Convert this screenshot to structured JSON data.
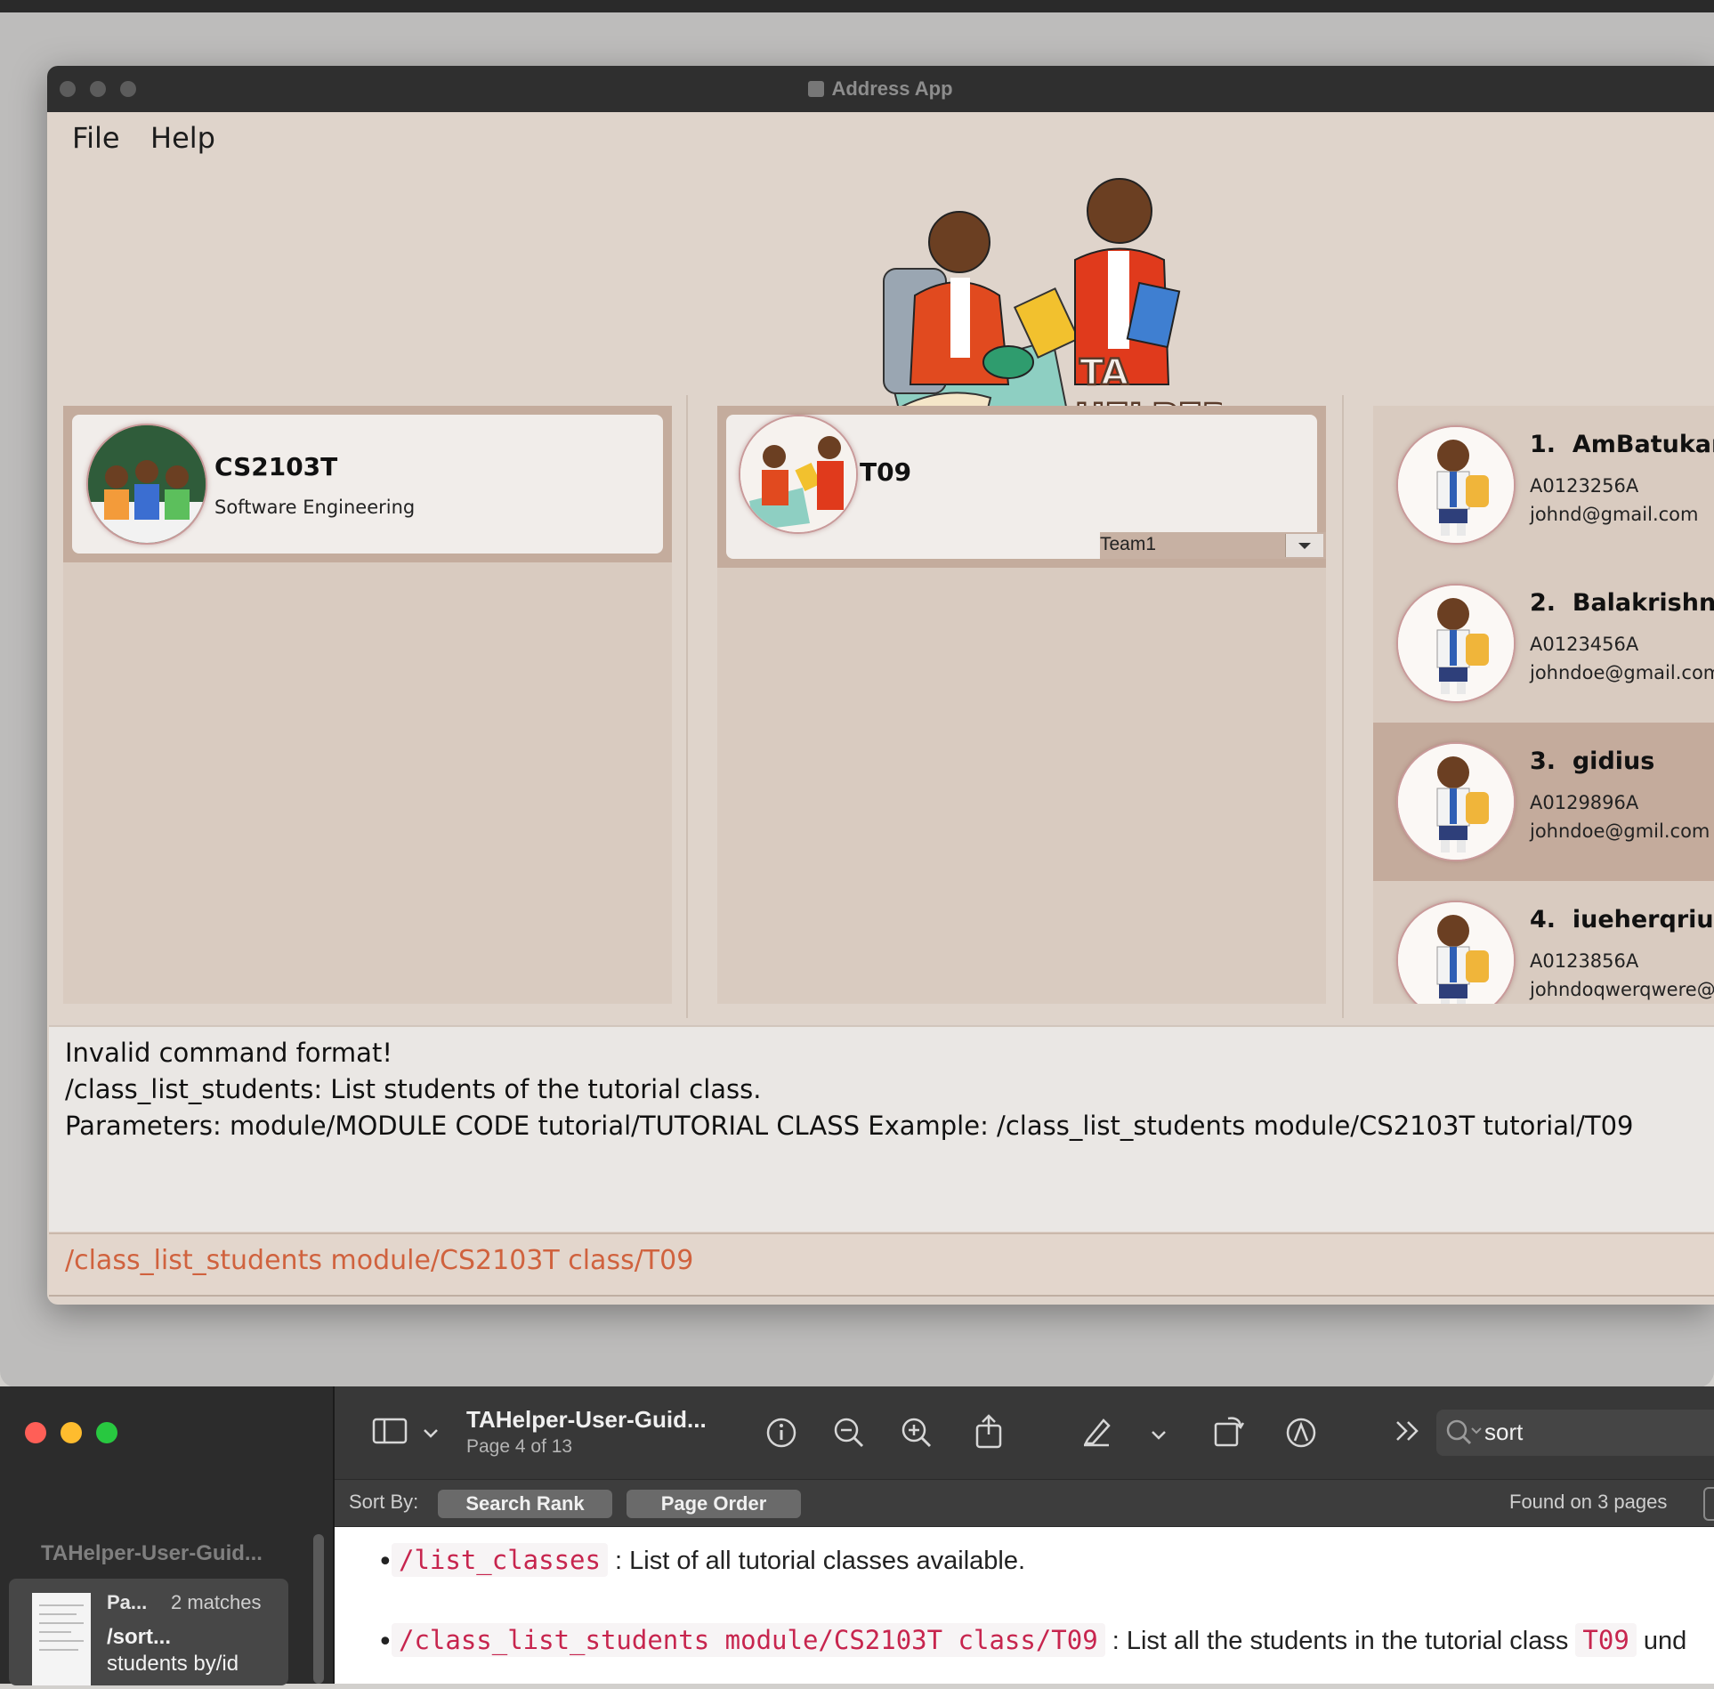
{
  "app": {
    "title": "Address App",
    "menu": [
      "File",
      "Help"
    ],
    "logo_text_top": "TA",
    "logo_text_bottom": "HELPER"
  },
  "module_card": {
    "code": "CS2103T",
    "name": "Software Engineering"
  },
  "class_card": {
    "name": "T09",
    "team_select": "Team1"
  },
  "students": [
    {
      "index": "1.",
      "name": "AmBatukam",
      "id": "A0123256A",
      "email": "johnd@gmail.com",
      "selected": false
    },
    {
      "index": "2.",
      "name": "Balakrishna",
      "id": "A0123456A",
      "email": "johndoe@gmail.com",
      "selected": false
    },
    {
      "index": "3.",
      "name": "gidius",
      "id": "A0129896A",
      "email": "johndoe@gmil.com",
      "selected": true
    },
    {
      "index": "4.",
      "name": "iueherqriuw",
      "id": "A0123856A",
      "email": "johndoqwerqwere@",
      "selected": false
    }
  ],
  "result": {
    "line1": "Invalid command format!",
    "line2": "/class_list_students: List students of the tutorial class.",
    "line3": "Parameters: module/MODULE CODE tutorial/TUTORIAL CLASS Example: /class_list_students module/CS2103T tutorial/T09"
  },
  "command_input": "/class_list_students module/CS2103T class/T09",
  "preview": {
    "doc_title": "TAHelper-User-Guid...",
    "page_info": "Page 4 of 13",
    "search_value": "sort",
    "sort_by_label": "Sort By:",
    "sort_buttons": [
      "Search Rank",
      "Page Order"
    ],
    "found_text": "Found on 3 pages",
    "sidebar_doc_title": "TAHelper-User-Guid...",
    "result_item": {
      "page": "Pa...",
      "matches": "2 matches",
      "snippet1": "/sort...",
      "snippet2": "students by/id"
    },
    "doc_lines": [
      {
        "code": "/list_classes",
        "text": " : List of all tutorial classes available."
      },
      {
        "code": "/class_list_students module/CS2103T class/T09",
        "text": " : List all the students in the tutorial class ",
        "code2": "T09",
        "text2": " und"
      }
    ]
  },
  "colors": {
    "accent_command": "#d0623e",
    "card_border": "#c4ac9d",
    "panel_bg": "#d9cbc0",
    "selected_row": "#c4ab9c"
  }
}
